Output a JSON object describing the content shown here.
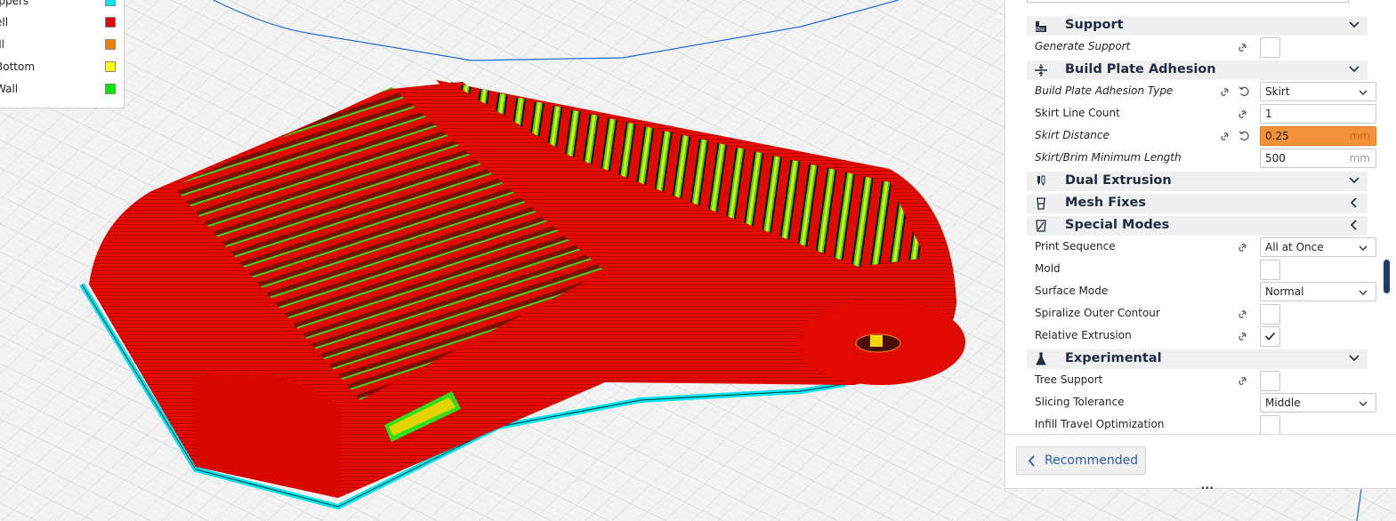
{
  "legend": {
    "items": [
      {
        "label": "ippers",
        "color": "#00e5ee"
      },
      {
        "label": "ell",
        "color": "#e80000"
      },
      {
        "label": "ill",
        "color": "#f08000"
      },
      {
        "label": "Bottom",
        "color": "#ffff00"
      },
      {
        "label": "Wall",
        "color": "#00e800"
      }
    ]
  },
  "panel": {
    "sections": {
      "support": {
        "title": "Support",
        "icon": "support-icon",
        "state": "expanded"
      },
      "adhesion": {
        "title": "Build Plate Adhesion",
        "icon": "adhesion-icon",
        "state": "expanded"
      },
      "dual": {
        "title": "Dual Extrusion",
        "icon": "dual-extrusion-icon",
        "state": "expanded"
      },
      "mesh": {
        "title": "Mesh Fixes",
        "icon": "mesh-fixes-icon",
        "state": "collapsed"
      },
      "special": {
        "title": "Special Modes",
        "icon": "special-modes-icon",
        "state": "collapsed"
      },
      "experimental": {
        "title": "Experimental",
        "icon": "experimental-icon",
        "state": "expanded"
      }
    },
    "settings": {
      "generate_support": {
        "label": "Generate Support",
        "checked": false
      },
      "adhesion_type": {
        "label": "Build Plate Adhesion Type",
        "value": "Skirt"
      },
      "skirt_line_count": {
        "label": "Skirt Line Count",
        "value": "1"
      },
      "skirt_distance": {
        "label": "Skirt Distance",
        "value": "0.25",
        "unit": "mm",
        "warning_color": "#f6913b"
      },
      "skirt_min_length": {
        "label": "Skirt/Brim Minimum Length",
        "value": "500",
        "unit": "mm"
      },
      "print_sequence": {
        "label": "Print Sequence",
        "value": "All at Once"
      },
      "mold": {
        "label": "Mold",
        "checked": false
      },
      "surface_mode": {
        "label": "Surface Mode",
        "value": "Normal"
      },
      "spiralize": {
        "label": "Spiralize Outer Contour",
        "checked": false
      },
      "relative_extrusion": {
        "label": "Relative Extrusion",
        "checked": true
      },
      "tree_support": {
        "label": "Tree Support",
        "checked": false
      },
      "slicing_tolerance": {
        "label": "Slicing Tolerance",
        "value": "Middle"
      },
      "infill_travel": {
        "label": "Infill Travel Optimization",
        "checked": false
      }
    },
    "recommended_button": "Recommended",
    "grip": "•••"
  },
  "colors": {
    "accent": "#2a5fb4",
    "model_red": "#e80000",
    "skirt_cyan": "#00e5ee"
  }
}
